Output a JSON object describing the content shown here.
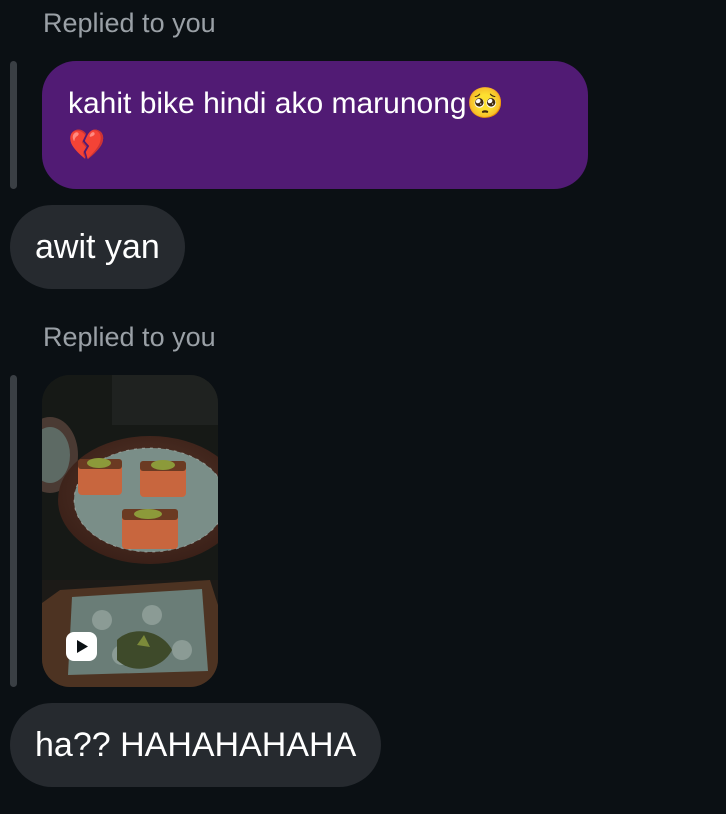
{
  "messages": [
    {
      "reply_label": "Replied to you",
      "quoted_text": "kahit bike hindi ako marunong",
      "quoted_emojis": [
        "🥺",
        "💔"
      ]
    },
    {
      "text": "awit yan"
    },
    {
      "reply_label": "Replied to you",
      "quoted_media": "video",
      "media_icon": "play-icon"
    },
    {
      "text": "ha?? HAHAHAHAHA"
    }
  ],
  "colors": {
    "background": "#0b1014",
    "quoted_bubble": "#511b74",
    "received_bubble": "#262a2f",
    "reply_label": "#9aa0a6"
  }
}
